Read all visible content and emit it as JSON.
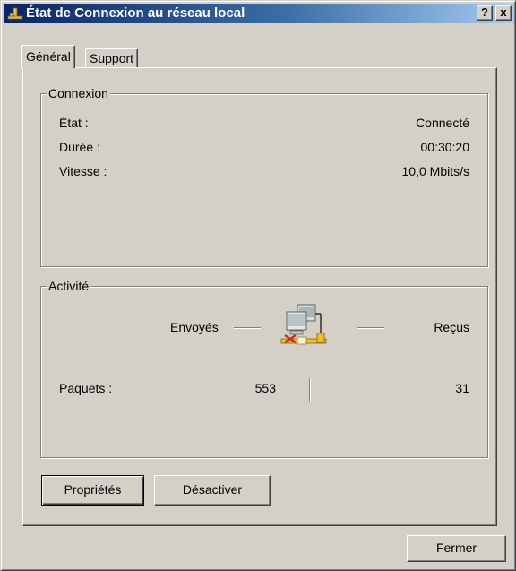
{
  "window": {
    "title": "État de Connexion au réseau local",
    "help_label": "?",
    "close_label": "x"
  },
  "tabs": [
    {
      "label": "Général",
      "active": true
    },
    {
      "label": "Support",
      "active": false
    }
  ],
  "connexion": {
    "legend": "Connexion",
    "rows": [
      {
        "label": "État :",
        "value": "Connecté"
      },
      {
        "label": "Durée :",
        "value": "00:30:20"
      },
      {
        "label": "Vitesse :",
        "value": "10,0 Mbits/s"
      }
    ]
  },
  "activite": {
    "legend": "Activité",
    "sent_label": "Envoyés",
    "received_label": "Reçus",
    "packets_label": "Paquets :",
    "packets_sent": "553",
    "packets_received": "31",
    "icon": "network-computers-icon"
  },
  "buttons": {
    "properties": "Propriétés",
    "disable": "Désactiver",
    "close": "Fermer"
  }
}
